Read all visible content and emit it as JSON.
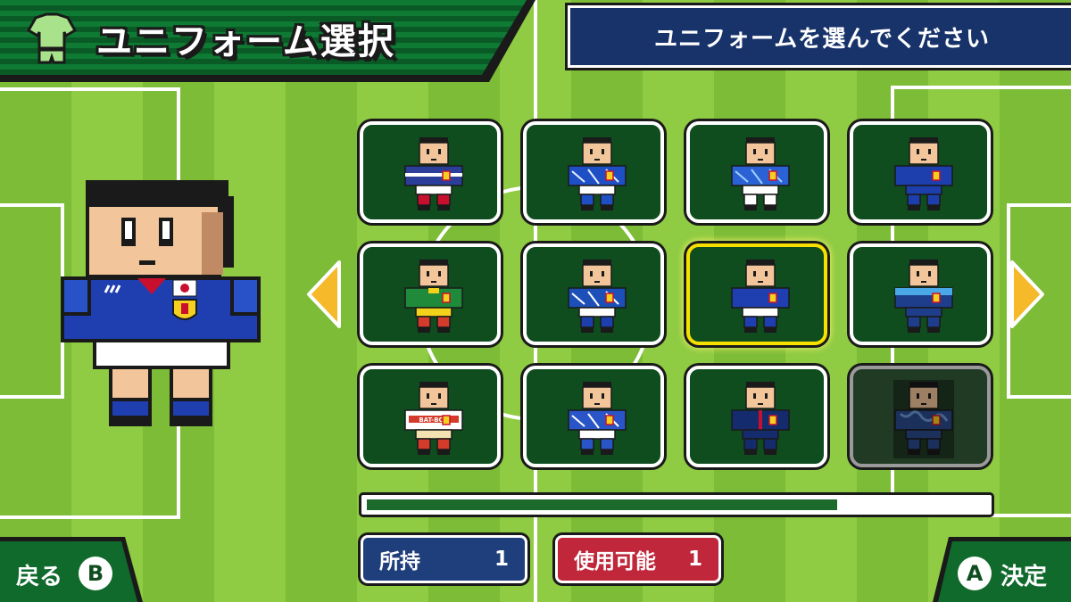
{
  "header": {
    "title": "ユニフォーム選択",
    "title_icon": "shirt-icon",
    "prompt": "ユニフォームを選んでください"
  },
  "grid": {
    "selected_index": 6,
    "items": [
      {
        "shirt": "#2b3f9a",
        "accent": "#ffffff",
        "shorts": "#ffffff",
        "socks": "#c8102e",
        "pattern": "stripe"
      },
      {
        "shirt": "#1f4fc4",
        "accent": "#e6f0ff",
        "shorts": "#ffffff",
        "socks": "#1f4fc4",
        "pattern": "flame"
      },
      {
        "shirt": "#2a62d6",
        "accent": "#9fd0ff",
        "shorts": "#ffffff",
        "socks": "#ffffff",
        "pattern": "wave"
      },
      {
        "shirt": "#1d3fae",
        "accent": "#3d6ad8",
        "shorts": "#1d3fae",
        "socks": "#1d3fae",
        "pattern": "plain"
      },
      {
        "shirt": "#1e8a3a",
        "accent": "#f2d21a",
        "shorts": "#f2d21a",
        "socks": "#d43b2a",
        "pattern": "collar"
      },
      {
        "shirt": "#1d4fb8",
        "accent": "#ffffff",
        "shorts": "#ffffff",
        "socks": "#1d3fae",
        "pattern": "lines"
      },
      {
        "shirt": "#1f3fb0",
        "accent": "#c8102e",
        "shorts": "#ffffff",
        "socks": "#1f3fb0",
        "pattern": "plain"
      },
      {
        "shirt": "#1e3e8c",
        "accent": "#4aa7e8",
        "shorts": "#1e3e8c",
        "socks": "#1e3e8c",
        "pattern": "gradient"
      },
      {
        "shirt": "#ffffff",
        "accent": "#d43b2a",
        "shorts": "#f3e3b0",
        "socks": "#d43b2a",
        "pattern": "text",
        "label": "BAT-BOX"
      },
      {
        "shirt": "#2a55c8",
        "accent": "#ffffff",
        "shorts": "#ffffff",
        "socks": "#2a55c8",
        "pattern": "diag"
      },
      {
        "shirt": "#142c6e",
        "accent": "#c8102e",
        "shorts": "#142c6e",
        "socks": "#142c6e",
        "pattern": "stripe-center"
      },
      {
        "shirt": "#2a4a8a",
        "accent": "#6a9ad8",
        "shorts": "#2a4a8a",
        "socks": "#2a4a8a",
        "pattern": "camo",
        "locked": true
      }
    ]
  },
  "preview": {
    "shirt": "#1f3fb0",
    "collar": "#c8102e",
    "shorts": "#ffffff",
    "socks": "#1f3fb0"
  },
  "progress": {
    "fraction": 0.76
  },
  "stats": {
    "owned_label": "所持",
    "owned_value": "1",
    "usable_label": "使用可能",
    "usable_value": "1"
  },
  "nav": {
    "back_label": "戻る",
    "back_button": "B",
    "confirm_label": "決定",
    "confirm_button": "A"
  },
  "colors": {
    "grass_dark": "#7cbc36",
    "grass_light": "#8fcb43",
    "card_bg": "#0f4d1f",
    "navy": "#17336a",
    "highlight": "#f7e000",
    "arrow": "#f5b92a"
  }
}
